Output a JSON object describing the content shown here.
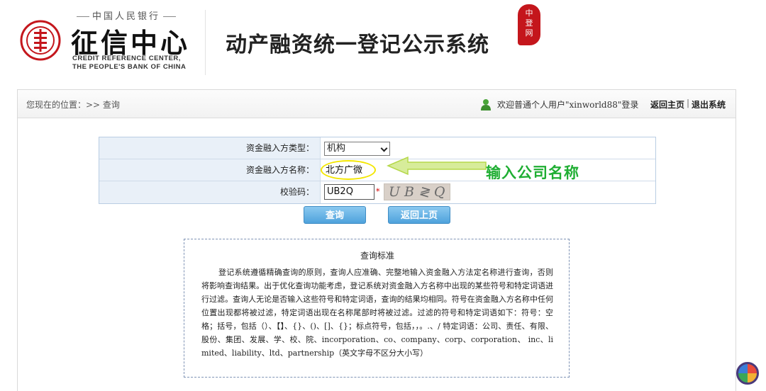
{
  "header": {
    "bank_name": "中国人民银行",
    "center_name": "征信中心",
    "en_line1": "CREDIT REFERENCE CENTER,",
    "en_line2": "THE PEOPLE'S BANK OF CHINA",
    "system_title": "动产融资统一登记公示系统",
    "badge_line1": "中",
    "badge_line2": "登",
    "badge_line3": "网"
  },
  "topbar": {
    "breadcrumb": "您现在的位置：>> 查询",
    "welcome": "欢迎普通个人用户\"xinworld88\"登录",
    "home_link": "返回主页",
    "separator": "|",
    "exit_link": "退出系统"
  },
  "form": {
    "type_label": "资金融入方类型：",
    "type_value": "机构",
    "name_label": "资金融入方名称：",
    "name_value": "北方广微",
    "code_label": "校验码：",
    "code_value": "UB2Q",
    "captcha_text": "UB≷Q",
    "required_mark": "*"
  },
  "annotation": {
    "text": "输入公司名称",
    "color": "#1fae32"
  },
  "buttons": {
    "query": "查询",
    "back": "返回上页"
  },
  "criteria": {
    "title": "查询标准",
    "body": "登记系统遵循精确查询的原则，查询人应准确、完整地输入资金融入方法定名称进行查询，否则将影响查询结果。出于优化查询功能考虑，登记系统对资金融入方名称中出现的某些符号和特定词语进行过滤。查询人无论是否输入这些符号和特定词语，查询的结果均相同。符号在资金融入方名称中任何位置出现都将被过滤，特定词语出现在名称尾部时将被过滤。过滤的符号和特定词语如下：符号：空格；括号，包括（）、【】、{}、()、[]、{}；标点符号，包括，，。.、/ 特定词语：公司、责任、有限、股份、集团、发展、学、校、院、incorporation、co、company、corp、corporation、 inc、limited、liability、ltd、partnership（英文字母不区分大小写）"
  },
  "colors": {
    "brand_red": "#c4161c",
    "button_blue": "#4ea2dc",
    "form_label_bg": "#e9f0f8"
  }
}
